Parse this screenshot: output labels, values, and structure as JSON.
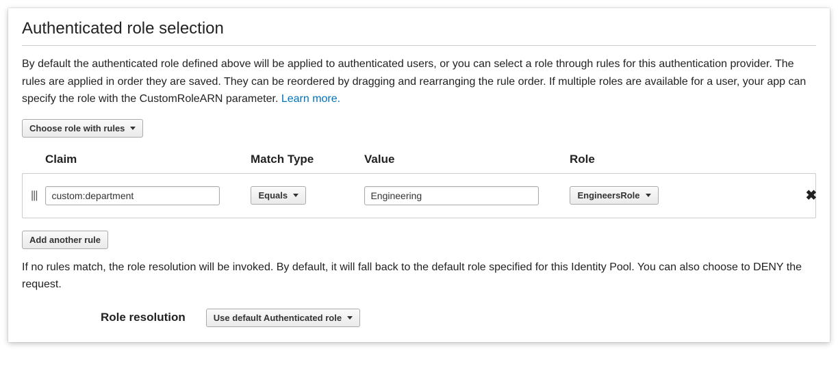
{
  "section": {
    "title": "Authenticated role selection",
    "description_pre": "By default the authenticated role defined above will be applied to authenticated users, or you can select a role through rules for this authentication provider. The rules are applied in order they are saved. They can be reordered by dragging and rearranging the rule order. If multiple roles are available for a user, your app can specify the role with the CustomRoleARN parameter. ",
    "learn_more": "Learn more.",
    "role_mode_button": "Choose role with rules"
  },
  "headers": {
    "claim": "Claim",
    "match_type": "Match Type",
    "value": "Value",
    "role": "Role"
  },
  "rule": {
    "claim": "custom:department",
    "match_type": "Equals",
    "value": "Engineering",
    "role": "EngineersRole"
  },
  "add_rule_button": "Add another rule",
  "resolution": {
    "description": "If no rules match, the role resolution will be invoked. By default, it will fall back to the default role specified for this Identity Pool. You can also choose to DENY the request.",
    "label": "Role resolution",
    "selected": "Use default Authenticated role"
  }
}
